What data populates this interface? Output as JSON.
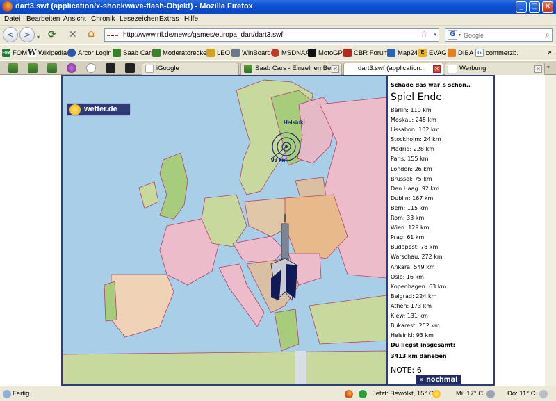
{
  "window": {
    "title": "dart3.swf (application/x-shockwave-flash-Objekt) - Mozilla Firefox",
    "minimize": "_",
    "maximize": "□",
    "close": "✕"
  },
  "menu": [
    "Datei",
    "Bearbeiten",
    "Ansicht",
    "Chronik",
    "Lesezeichen",
    "Extras",
    "Hilfe"
  ],
  "nav": {
    "back": "<",
    "forward": ">",
    "reload": "⟳",
    "stop": "✕",
    "home": "⌂",
    "url": "http://www.rtl.de/news/games/europa_dart/dart3.swf",
    "star": "☆",
    "dropdown": "▾",
    "search_engine": "G",
    "search_placeholder": "Google",
    "search_go": "⌕"
  },
  "bookmarks": [
    {
      "label": "FOM",
      "icon": "FOM",
      "color": "#1f7a3a"
    },
    {
      "label": "Wikipedia",
      "icon": "W",
      "color": "#444444"
    },
    {
      "label": "Arcor Login",
      "icon": "",
      "color": "#2c55a8"
    },
    {
      "label": "Saab Cars",
      "icon": "",
      "color": "#3a7f2b"
    },
    {
      "label": "Moderatorecke",
      "icon": "",
      "color": "#3a7f2b"
    },
    {
      "label": "LEO",
      "icon": "",
      "color": "#d4a21a"
    },
    {
      "label": "WinBoard",
      "icon": "",
      "color": "#6a7a8d"
    },
    {
      "label": "MSDNAA",
      "icon": "",
      "color": "#c0392b"
    },
    {
      "label": "MotoGP",
      "icon": "",
      "color": "#111111"
    },
    {
      "label": "CBR Forum",
      "icon": "",
      "color": "#b4281e"
    },
    {
      "label": "Map24",
      "icon": "",
      "color": "#2a62b8"
    },
    {
      "label": "EVAG",
      "icon": "E",
      "color": "#e9b313"
    },
    {
      "label": "DIBA",
      "icon": "",
      "color": "#e67e22"
    },
    {
      "label": "commerzb.",
      "icon": "G",
      "color": "#2a62b8"
    }
  ],
  "bookmarks_more": "»",
  "tabs": [
    {
      "label": "iGoogle",
      "active": false
    },
    {
      "label": "Saab Cars - Einzelnen Beit...",
      "active": false
    },
    {
      "label": "dart3.swf (application...",
      "active": true
    },
    {
      "label": "Werbung",
      "active": false
    }
  ],
  "tab_close": "✕",
  "game": {
    "brand": "wetter.de",
    "city_label": "Helsinki",
    "distance_label": "93 km",
    "header": "Schade das war`s schon..",
    "end_title": "Spiel Ende",
    "results": [
      "Berlin: 110 km",
      "Moskau: 245 km",
      "Lissabon: 102 km",
      "Stockholm: 24 km",
      "Madrid: 228 km",
      "Paris: 155 km",
      "London: 26 km",
      "Brüssel: 75 km",
      "Den Haag: 92 km",
      "Dublin: 167 km",
      "Bern: 115 km",
      "Rom: 33 km",
      "Wien: 129 km",
      "Prag: 61 km",
      "Budapest: 78 km",
      "Warschau: 272 km",
      "Ankara: 549 km",
      "Oslo: 16 km",
      "Kopenhagen: 63 km",
      "Belgrad: 224 km",
      "Athen: 173 km",
      "Kiew: 131 km",
      "Bukarest: 252 km",
      "Helsinki: 93 km"
    ],
    "total_label": "Du liegst insgesamt:",
    "total_value": "3413  km daneben",
    "note": "NOTE: 6",
    "again_button": "» nochmal"
  },
  "status": {
    "text": "Fertig",
    "weather_now": "Jetzt: Bewölkt, 15° C",
    "weather_wed": "Mi: 17° C",
    "weather_thu": "Do: 11° C"
  }
}
